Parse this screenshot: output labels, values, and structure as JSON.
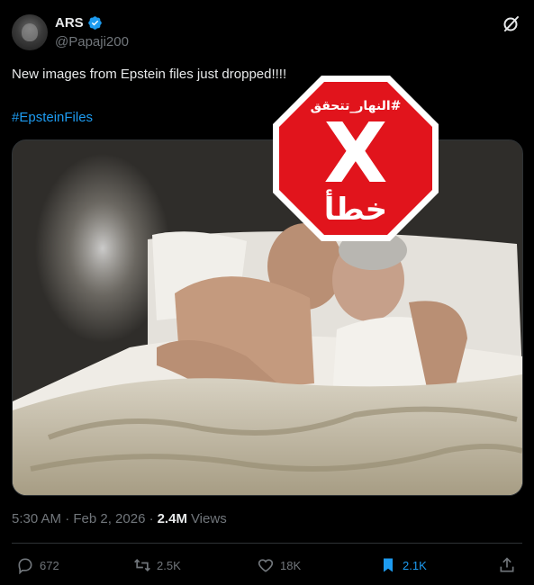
{
  "author": {
    "name": "ARS",
    "handle": "@Papaji200"
  },
  "tweet": {
    "text": "New images from Epstein files just dropped!!!!",
    "hashtag": "#EpsteinFiles"
  },
  "factcheck": {
    "brand": "#النهار_تتحقق",
    "verdict": "خطأ",
    "mark": "X"
  },
  "meta": {
    "timestamp": "5:30 AM · Feb 2, 2026 · ",
    "views_count": "2.4M",
    "views_label": "Views"
  },
  "actions": {
    "replies": "672",
    "reposts": "2.5K",
    "likes": "18K",
    "bookmarks": "2.1K"
  },
  "colors": {
    "accent": "#1d9bf0",
    "stop_red": "#e1141c",
    "background": "#000000"
  }
}
